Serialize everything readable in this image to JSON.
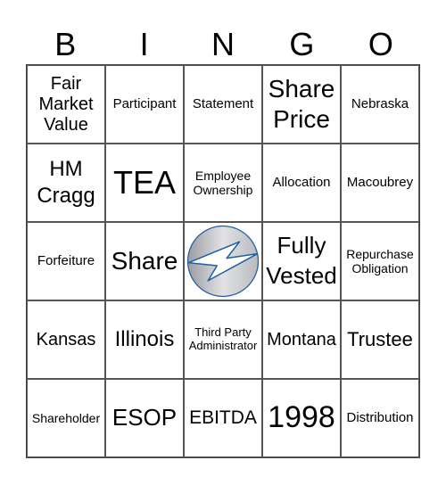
{
  "header": [
    "B",
    "I",
    "N",
    "G",
    "O"
  ],
  "cells": [
    [
      "Fair Market Value",
      "Participant",
      "Statement",
      "Share Price",
      "Nebraska"
    ],
    [
      "HM Cragg",
      "TEA",
      "Employee Ownership",
      "Allocation",
      "Macoubrey"
    ],
    [
      "Forfeiture",
      "Share",
      "",
      "Fully Vested",
      "Repurchase Obligation"
    ],
    [
      "Kansas",
      "Illinois",
      "Third Party Administrator",
      "Montana",
      "Trustee"
    ],
    [
      "Shareholder",
      "ESOP",
      "EBITDA",
      "1998",
      "Distribution"
    ]
  ],
  "free_space": {
    "icon": "lightning-bolt-logo-icon",
    "colors": {
      "silver": "#c0c2c6",
      "blue": "#1f5ea8"
    }
  }
}
